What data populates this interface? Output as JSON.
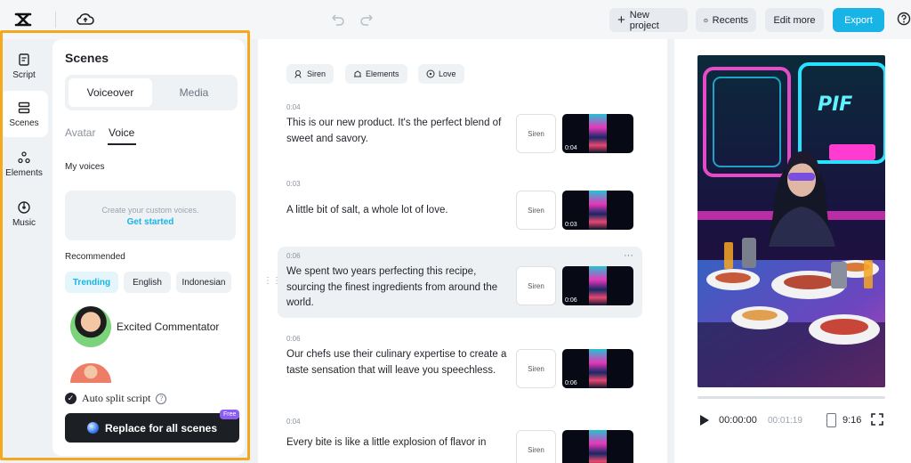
{
  "topbar": {
    "new_project": "New project",
    "recents": "Recents",
    "edit_more": "Edit more",
    "export": "Export",
    "accent": "#18b4e6"
  },
  "rail": [
    {
      "label": "Script",
      "icon": "script-icon"
    },
    {
      "label": "Scenes",
      "icon": "scenes-icon",
      "active": true
    },
    {
      "label": "Elements",
      "icon": "elements-icon"
    },
    {
      "label": "Music",
      "icon": "music-icon"
    }
  ],
  "panel": {
    "title": "Scenes",
    "segments": [
      "Voiceover",
      "Media"
    ],
    "subtabs": [
      "Avatar",
      "Voice"
    ],
    "my_voices": "My voices",
    "custom_text": "Create your custom voices.",
    "get_started": "Get started",
    "recommended": "Recommended",
    "chips": [
      "Trending",
      "English",
      "Indonesian"
    ],
    "voices": [
      "Excited Commentator"
    ],
    "auto_split": "Auto split script",
    "replace_btn": "Replace for all scenes",
    "free_badge": "Free",
    "highlight_color": "#f4a81d"
  },
  "script": {
    "tags": [
      "Siren",
      "Elements",
      "Love"
    ],
    "scenes": [
      {
        "time": "0:04",
        "text": "This is our new product. It's the perfect blend of sweet and savory.",
        "voice": "Siren",
        "duration": "0:04"
      },
      {
        "time": "0:03",
        "text": "A little bit of salt, a whole lot of love.",
        "voice": "Siren",
        "duration": "0:03"
      },
      {
        "time": "0:06",
        "text": "We spent two years perfecting this recipe, sourcing the finest ingredients from around the world.",
        "voice": "Siren",
        "duration": "0:06",
        "selected": true
      },
      {
        "time": "0:06",
        "text": "Our chefs use their culinary expertise to create a taste sensation that will leave you speechless.",
        "voice": "Siren",
        "duration": "0:06"
      },
      {
        "time": "0:04",
        "text": "Every bite is like a little explosion of flavor in",
        "voice": "Siren",
        "duration": ""
      }
    ]
  },
  "preview": {
    "current_time": "00:00:00",
    "total_time": "00:01:19",
    "ratio": "9:16",
    "progress": 0
  }
}
